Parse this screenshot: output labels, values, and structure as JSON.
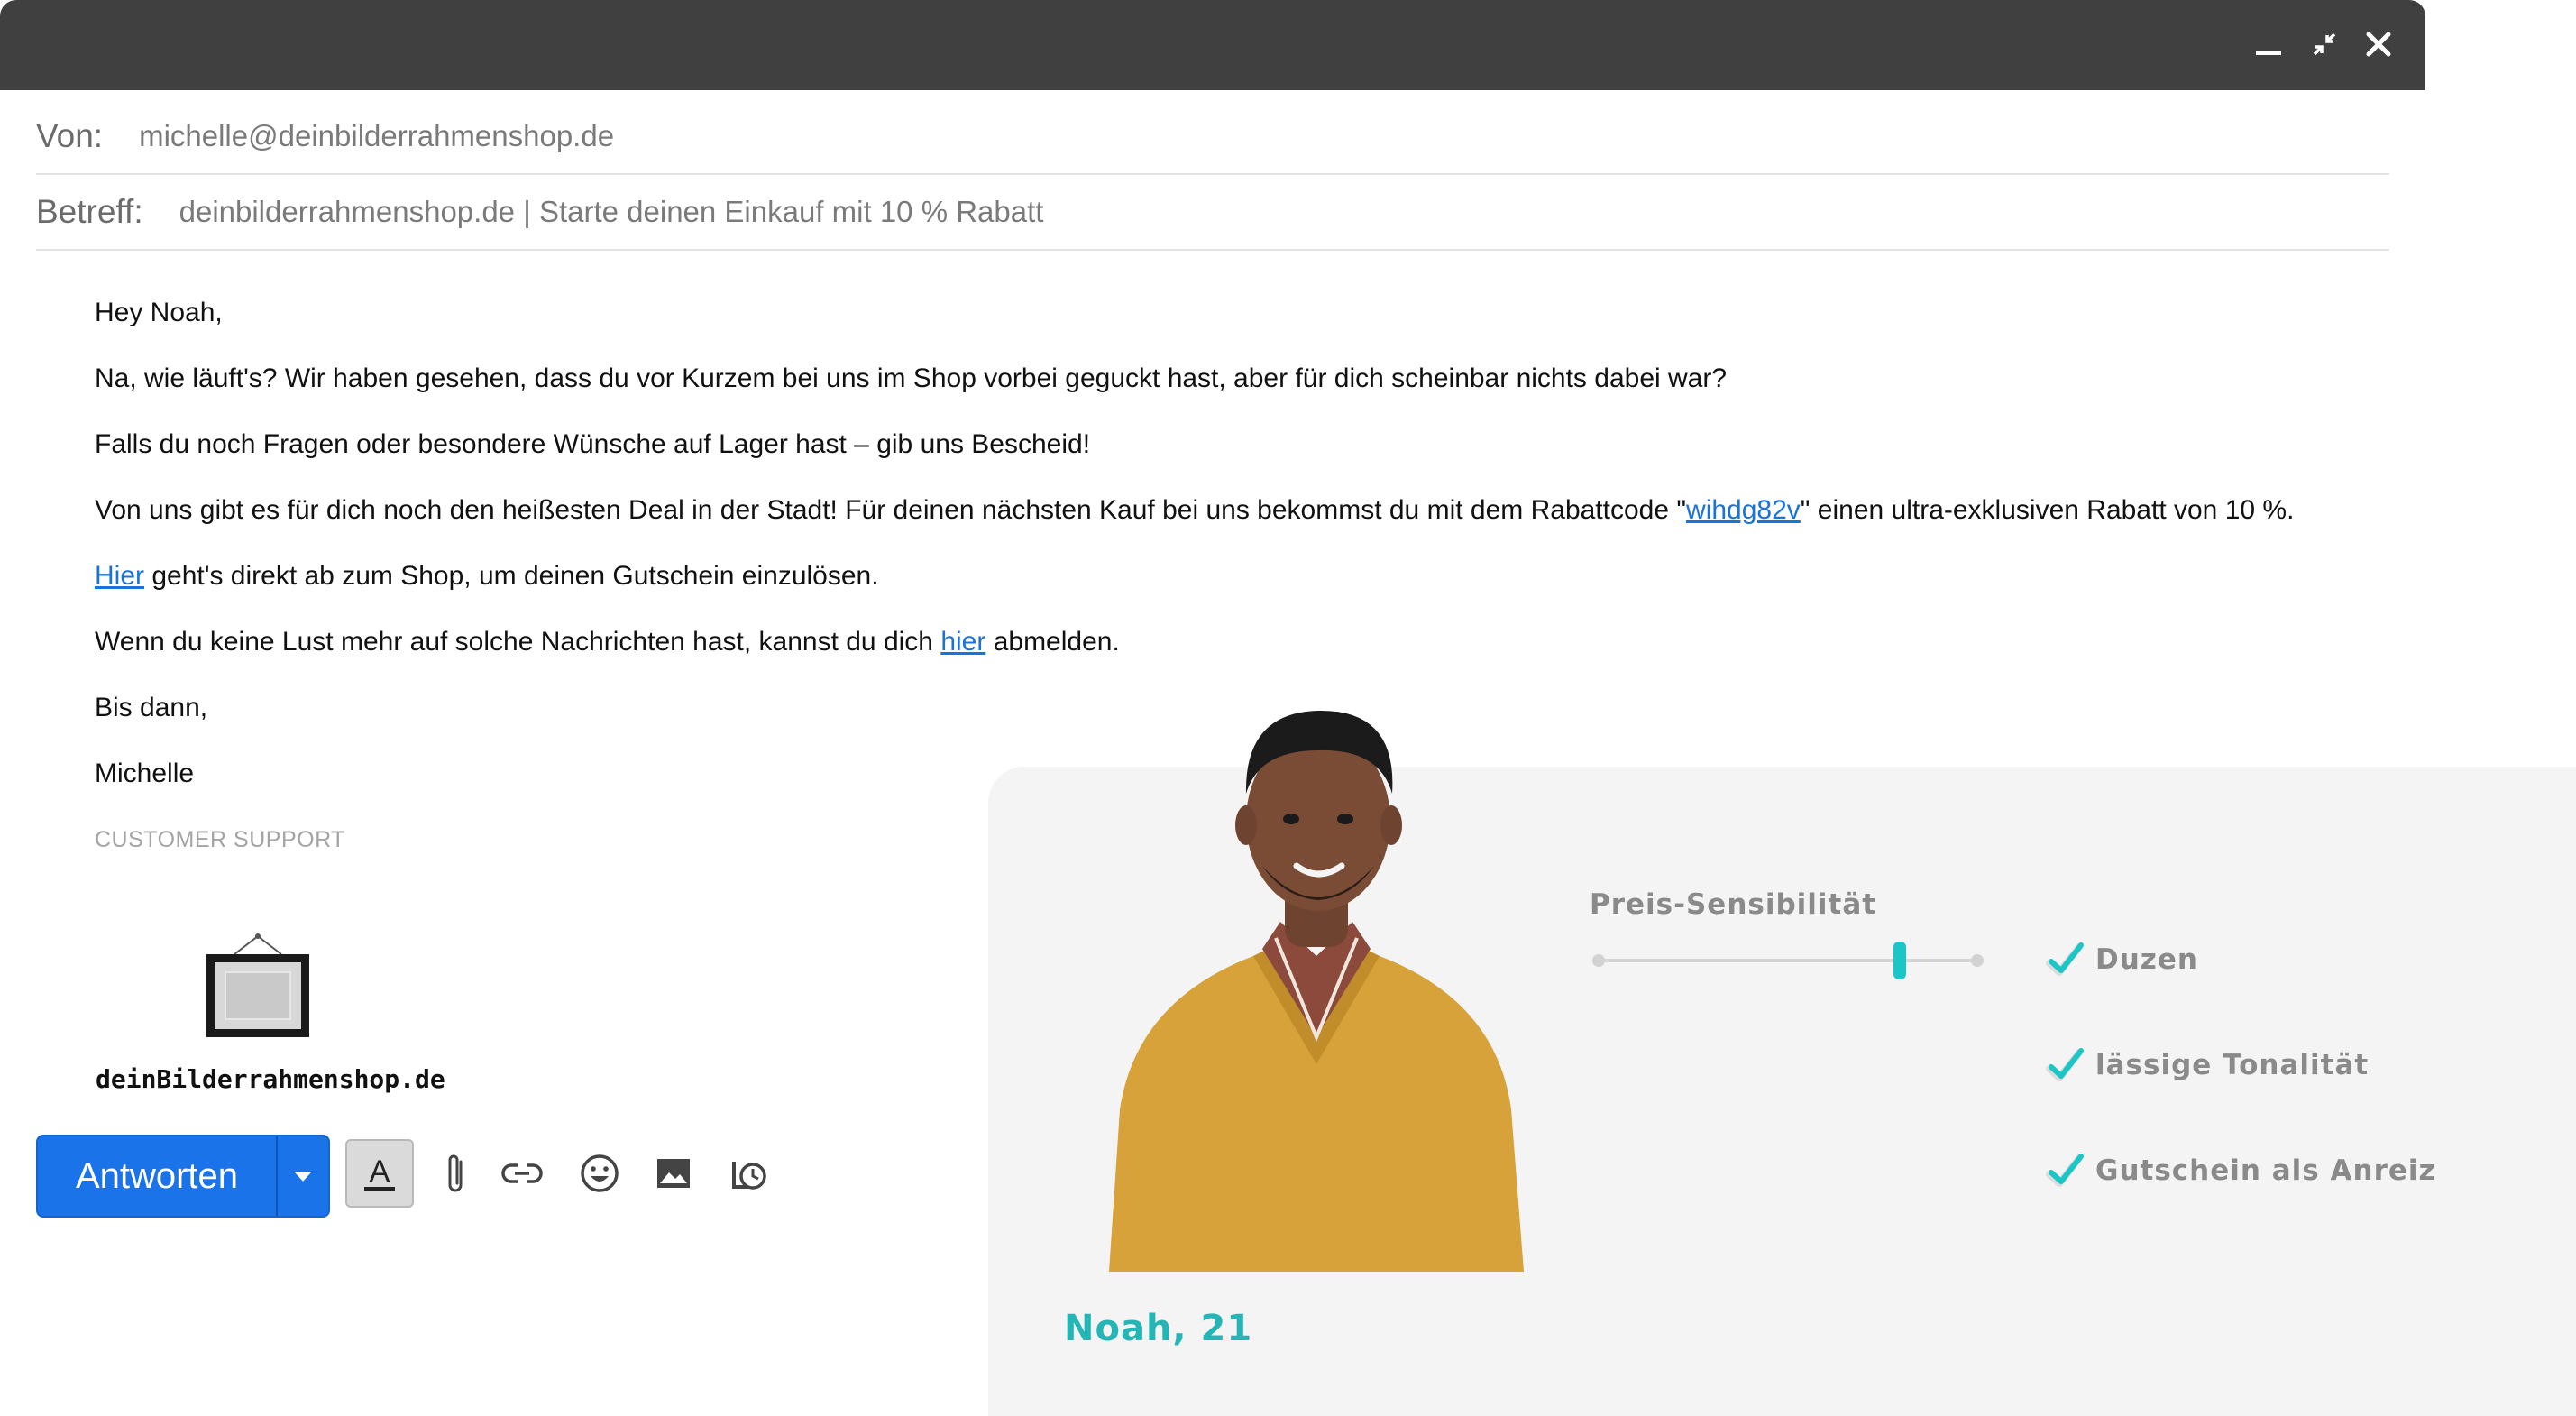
{
  "window": {
    "controls": [
      "minimize-icon",
      "shrink-icon",
      "close-icon"
    ],
    "titlebar_color": "#404040"
  },
  "header": {
    "from_label": "Von:",
    "from_value": "michelle@deinbilderrahmenshop.de",
    "subject_label": "Betreff:",
    "subject_value": "deinbilderrahmenshop.de | Starte deinen Einkauf mit 10 % Rabatt"
  },
  "body": {
    "greeting": "Hey Noah,",
    "p1": "Na, wie läuft's? Wir haben gesehen, dass du vor Kurzem bei uns im Shop vorbei geguckt hast, aber für dich scheinbar nichts dabei war?",
    "p2": "Falls du noch Fragen oder besondere Wünsche auf Lager hast – gib uns Bescheid!",
    "p3_before": "Von uns gibt es für dich noch  den heißesten Deal in der Stadt! Für deinen nächsten Kauf bei uns bekommst du mit dem Rabattcode  \"",
    "p3_code": "wihdg82v",
    "p3_after": "\" einen ultra-exklusiven Rabatt von 10 %.",
    "p4_link": "Hier",
    "p4_text": " geht's direkt ab zum Shop, um deinen Gutschein einzulösen.",
    "p5_before": "Wenn du keine Lust mehr auf solche Nachrichten hast, kannst du dich ",
    "p5_link": "hier",
    "p5_after": " abmelden.",
    "closing": "Bis dann,",
    "signature_name": "Michelle",
    "signature_role": "CUSTOMER SUPPORT",
    "logo_text": "deinBilderrahmenshop.de"
  },
  "toolbar": {
    "reply_label": "Antworten",
    "reply_color": "#1a73e8",
    "icons": [
      "text-format-icon",
      "paperclip-icon",
      "link-icon",
      "emoji-icon",
      "image-icon",
      "schedule-icon"
    ]
  },
  "persona": {
    "name": "Noah, 21",
    "accent_color": "#25b5b5",
    "slider_title": "Preis-Sensibilität",
    "price_sensitivity_level": 0.84,
    "traits": [
      "Duzen",
      "lässige Tonalität",
      "Gutschein als Anreiz"
    ]
  }
}
